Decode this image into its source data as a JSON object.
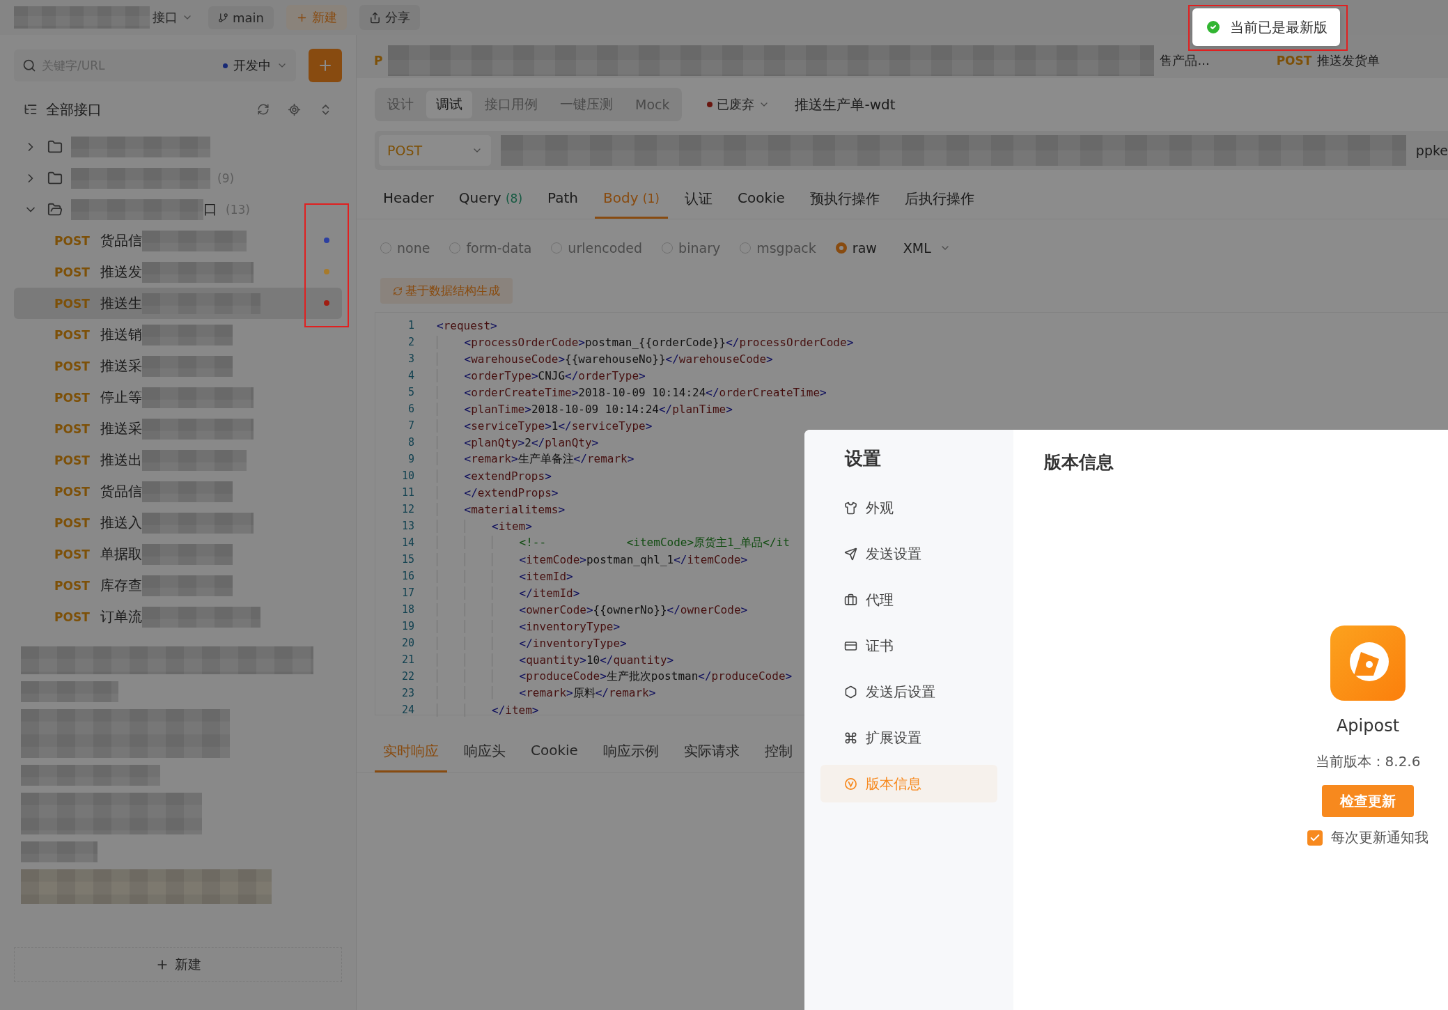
{
  "top_bar": {
    "project": "接口",
    "branch": "main",
    "new_button": "新建",
    "share_button": "分享"
  },
  "open_tabs": [
    {
      "method": "P"
    },
    {
      "title": "售产品..."
    },
    {
      "method": "POST",
      "title": "推送发货单"
    }
  ],
  "sidebar": {
    "search": {
      "placeholder": "关键字/URL"
    },
    "environment": "开发中",
    "tree_title": "全部接口",
    "markers_highlighted": true,
    "tree": [
      {
        "kind": "folder",
        "expanded": false
      },
      {
        "kind": "folder",
        "expanded": false,
        "count": "(9)"
      },
      {
        "kind": "folder",
        "expanded": true,
        "name_tail": "口",
        "count": "(13)",
        "children": [
          {
            "method": "POST",
            "name": "货品信",
            "selected": false,
            "color": "#2c3fa0"
          },
          {
            "method": "POST",
            "name": "推送发",
            "selected": false,
            "color": "#a77a2a"
          },
          {
            "method": "POST",
            "name": "推送生",
            "selected": true,
            "color": "#a01d12"
          },
          {
            "method": "POST",
            "name": "推送销",
            "selected": false
          },
          {
            "method": "POST",
            "name": "推送采",
            "selected": false
          },
          {
            "method": "POST",
            "name": "停止等",
            "selected": false
          },
          {
            "method": "POST",
            "name": "推送采",
            "selected": false
          },
          {
            "method": "POST",
            "name": "推送出",
            "selected": false
          },
          {
            "method": "POST",
            "name": "货品信",
            "selected": false
          },
          {
            "method": "POST",
            "name": "推送入",
            "selected": false
          },
          {
            "method": "POST",
            "name": "单据取",
            "selected": false
          },
          {
            "method": "POST",
            "name": "库存查",
            "selected": false
          },
          {
            "method": "POST",
            "name": "订单流",
            "selected": false
          }
        ]
      }
    ],
    "new_button": "新建"
  },
  "request": {
    "mode_tabs": [
      {
        "label": "设计",
        "selected": false
      },
      {
        "label": "调试",
        "selected": true
      },
      {
        "label": "接口用例",
        "selected": false
      },
      {
        "label": "一键压测",
        "selected": false
      },
      {
        "label": "Mock",
        "selected": false
      }
    ],
    "status": "已废弃",
    "name": "推送生产单-wdt",
    "method": "POST",
    "url_tail": "ppke",
    "param_tabs": [
      {
        "label": "Header",
        "selected": false
      },
      {
        "label": "Query",
        "count": "(8)",
        "selected": false
      },
      {
        "label": "Path",
        "selected": false
      },
      {
        "label": "Body",
        "count": "(1)",
        "selected": true
      },
      {
        "label": "认证",
        "selected": false
      },
      {
        "label": "Cookie",
        "selected": false
      },
      {
        "label": "预执行操作",
        "selected": false
      },
      {
        "label": "后执行操作",
        "selected": false
      }
    ],
    "body_types": [
      {
        "label": "none",
        "selected": false
      },
      {
        "label": "form-data",
        "selected": false
      },
      {
        "label": "urlencoded",
        "selected": false
      },
      {
        "label": "binary",
        "selected": false
      },
      {
        "label": "msgpack",
        "selected": false
      },
      {
        "label": "raw",
        "selected": true
      }
    ],
    "format": "XML",
    "generate_button": "基于数据结构生成",
    "code_lines": [
      {
        "number": "1",
        "text": "<request>"
      },
      {
        "number": "2",
        "text": "    <processOrderCode>postman_{{orderCode}}</processOrderCode>"
      },
      {
        "number": "3",
        "text": "    <warehouseCode>{{warehouseNo}}</warehouseCode>"
      },
      {
        "number": "4",
        "text": "    <orderType>CNJG</orderType>"
      },
      {
        "number": "5",
        "text": "    <orderCreateTime>2018-10-09 10:14:24</orderCreateTime>"
      },
      {
        "number": "6",
        "text": "    <planTime>2018-10-09 10:14:24</planTime>"
      },
      {
        "number": "7",
        "text": "    <serviceType>1</serviceType>"
      },
      {
        "number": "8",
        "text": "    <planQty>2</planQty>"
      },
      {
        "number": "9",
        "text": "    <remark>生产单备注</remark>"
      },
      {
        "number": "10",
        "text": "    <extendProps>"
      },
      {
        "number": "11",
        "text": "    </extendProps>"
      },
      {
        "number": "12",
        "text": "    <materialitems>"
      },
      {
        "number": "13",
        "text": "        <item>"
      },
      {
        "number": "14",
        "kind": "comment",
        "text": "            <!--            <itemCode>原货主1_单品</it"
      },
      {
        "number": "15",
        "text": "            <itemCode>postman_qhl_1</itemCode>"
      },
      {
        "number": "16",
        "text": "            <itemId>"
      },
      {
        "number": "17",
        "text": "            </itemId>"
      },
      {
        "number": "18",
        "text": "            <ownerCode>{{ownerNo}}</ownerCode>"
      },
      {
        "number": "19",
        "text": "            <inventoryType>"
      },
      {
        "number": "20",
        "text": "            </inventoryType>"
      },
      {
        "number": "21",
        "text": "            <quantity>10</quantity>"
      },
      {
        "number": "22",
        "text": "            <produceCode>生产批次postman</produceCode>"
      },
      {
        "number": "23",
        "text": "            <remark>原料</remark>"
      },
      {
        "number": "24",
        "text": "        </item>"
      }
    ]
  },
  "response_tabs": [
    {
      "label": "实时响应",
      "selected": true
    },
    {
      "label": "响应头",
      "selected": false
    },
    {
      "label": "Cookie",
      "selected": false
    },
    {
      "label": "响应示例",
      "selected": false
    },
    {
      "label": "实际请求",
      "selected": false
    },
    {
      "label": "控制",
      "selected": false
    }
  ],
  "settings_dialog": {
    "title": "设置",
    "nav": [
      {
        "label": "外观",
        "selected": false
      },
      {
        "label": "发送设置",
        "selected": false
      },
      {
        "label": "代理",
        "selected": false
      },
      {
        "label": "证书",
        "selected": false
      },
      {
        "label": "发送后设置",
        "selected": false
      },
      {
        "label": "扩展设置",
        "selected": false
      },
      {
        "label": "版本信息",
        "selected": true
      }
    ],
    "heading": "版本信息",
    "app_name": "Apipost",
    "version": "当前版本：8.2.6",
    "check_button": "检查更新",
    "notify": {
      "label": "每次更新通知我",
      "checked": true
    }
  },
  "toast": {
    "message": "当前已是最新版",
    "highlighted": true
  }
}
